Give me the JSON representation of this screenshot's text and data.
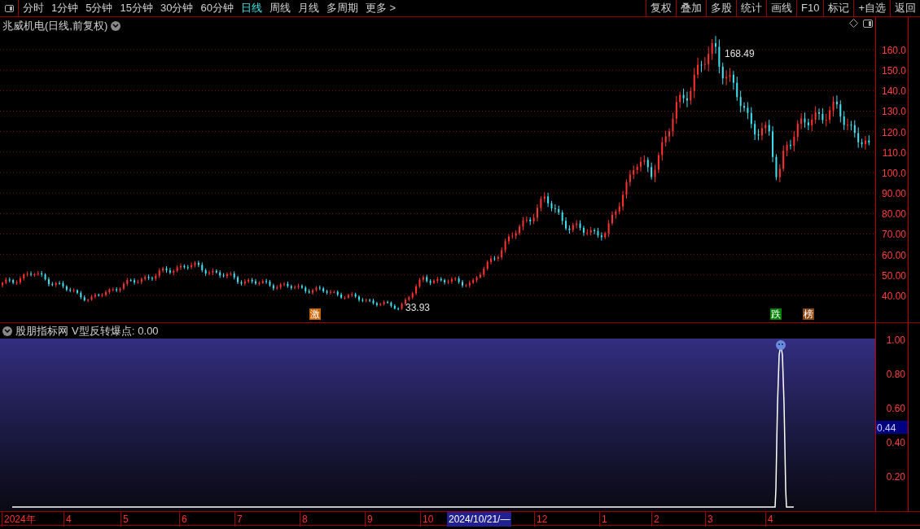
{
  "toolbar": {
    "periods": [
      {
        "label": "分时",
        "selected": false
      },
      {
        "label": "1分钟",
        "selected": false
      },
      {
        "label": "5分钟",
        "selected": false
      },
      {
        "label": "15分钟",
        "selected": false
      },
      {
        "label": "30分钟",
        "selected": false
      },
      {
        "label": "60分钟",
        "selected": false
      },
      {
        "label": "日线",
        "selected": true
      },
      {
        "label": "周线",
        "selected": false
      },
      {
        "label": "月线",
        "selected": false
      },
      {
        "label": "多周期",
        "selected": false
      },
      {
        "label": "更多 >",
        "selected": false
      }
    ],
    "buttons": [
      "复权",
      "叠加",
      "多股",
      "统计",
      "画线",
      "F10",
      "标记",
      "+自选",
      "返回"
    ]
  },
  "main_chart": {
    "title": "兆威机电(日线,前复权)",
    "high_label": "168.49",
    "low_label": "33.93",
    "y_ticks": [
      "160.0",
      "150.0",
      "140.0",
      "130.0",
      "120.0",
      "110.0",
      "100.0",
      "90.00",
      "80.00",
      "70.00",
      "60.00",
      "50.00",
      "40.00"
    ],
    "tags": [
      {
        "text": "激",
        "color": "#c86400"
      },
      {
        "text": "跌",
        "color": "#008000"
      },
      {
        "text": "榜",
        "color": "#8b4513"
      }
    ]
  },
  "indicator": {
    "source": "股朋指标网",
    "name": "V型反转爆点:",
    "value": "0.00",
    "y_ticks": [
      "1.00",
      "0.80",
      "0.60",
      "0.40",
      "0.20"
    ],
    "current": "0.44"
  },
  "date_axis": [
    {
      "label": "2024年",
      "selected": false
    },
    {
      "label": "4",
      "selected": false
    },
    {
      "label": "5",
      "selected": false
    },
    {
      "label": "6",
      "selected": false
    },
    {
      "label": "7",
      "selected": false
    },
    {
      "label": "8",
      "selected": false
    },
    {
      "label": "9",
      "selected": false
    },
    {
      "label": "10",
      "selected": false
    },
    {
      "label": "2024/10/21/—",
      "selected": true
    },
    {
      "label": "12",
      "selected": false
    },
    {
      "label": "1",
      "selected": false
    },
    {
      "label": "2",
      "selected": false
    },
    {
      "label": "3",
      "selected": false
    },
    {
      "label": "4",
      "selected": false
    }
  ]
}
